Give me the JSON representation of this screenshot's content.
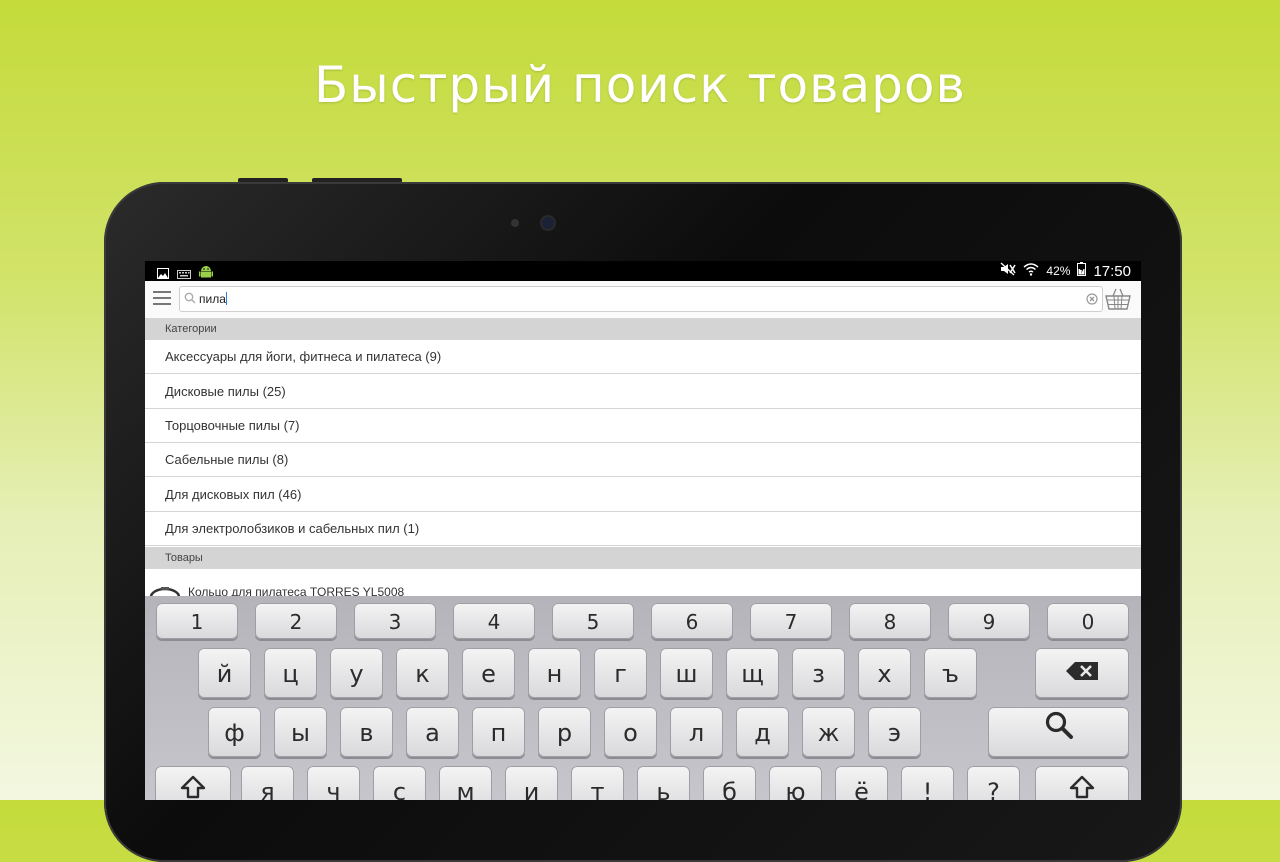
{
  "headline": "Быстрый поиск товаров",
  "statusbar": {
    "battery": "42%",
    "time": "17:50",
    "icons": [
      "image-icon",
      "keyboard-icon",
      "android-icon",
      "mute-icon",
      "wifi-icon",
      "battery-icon"
    ]
  },
  "search": {
    "value": "пила"
  },
  "sections": {
    "categories_label": "Категории",
    "products_label": "Товары"
  },
  "categories": [
    "Аксессуары для йоги, фитнеса и пилатеса (9)",
    "Дисковые пилы (25)",
    "Торцовочные пилы (7)",
    "Сабельные пилы (8)",
    "Для дисковых пил (46)",
    "Для электролобзиков и сабельных пил (1)"
  ],
  "products": [
    "Кольцо для пилатеса TORRES YL5008"
  ],
  "keyboard": {
    "numbers": [
      "1",
      "2",
      "3",
      "4",
      "5",
      "6",
      "7",
      "8",
      "9",
      "0"
    ],
    "row1": [
      "й",
      "ц",
      "у",
      "к",
      "е",
      "н",
      "г",
      "ш",
      "щ",
      "з",
      "х",
      "ъ"
    ],
    "row2": [
      "ф",
      "ы",
      "в",
      "а",
      "п",
      "р",
      "о",
      "л",
      "д",
      "ж",
      "э"
    ],
    "row3": [
      "я",
      "ч",
      "с",
      "м",
      "и",
      "т",
      "ь",
      "б",
      "ю",
      "ё",
      "!",
      "?"
    ]
  },
  "colors": {
    "background_top": "#c4db3a",
    "accent_caret": "#2a7de1"
  }
}
